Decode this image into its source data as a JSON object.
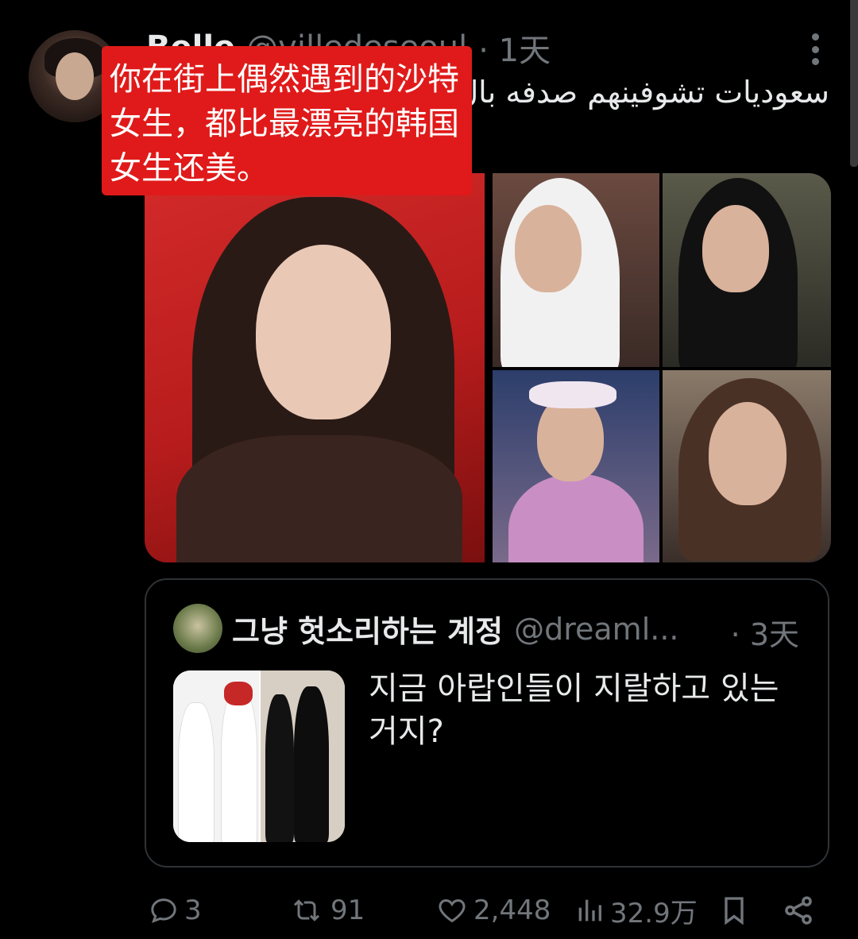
{
  "tweet": {
    "display_name": "Belle",
    "handle": "@villedeseoul",
    "time": "· 1天",
    "text": "سعوديات تشوفينهم صدفه بال... كوريه",
    "overlay_caption": "你在街上偶然遇到的沙特女生，都比最漂亮的韩国女生还美。"
  },
  "quote": {
    "display_name": "그냥 헛소리하는 계정",
    "handle": "@dreaml...",
    "time": "· 3天",
    "text": "지금 아랍인들이 지랄하고 있는 거지?"
  },
  "actions": {
    "replies": "3",
    "retweets": "91",
    "likes": "2,448",
    "views": "32.9万"
  },
  "icons": {
    "reply": "reply-icon",
    "retweet": "retweet-icon",
    "like": "heart-icon",
    "views": "views-icon",
    "bookmark": "bookmark-icon",
    "share": "share-icon",
    "more": "more-icon"
  },
  "colors": {
    "background": "#000000",
    "text_primary": "#e7e9ea",
    "text_secondary": "#71767b",
    "border": "#2f3336",
    "caption_red": "#e01a1a"
  }
}
